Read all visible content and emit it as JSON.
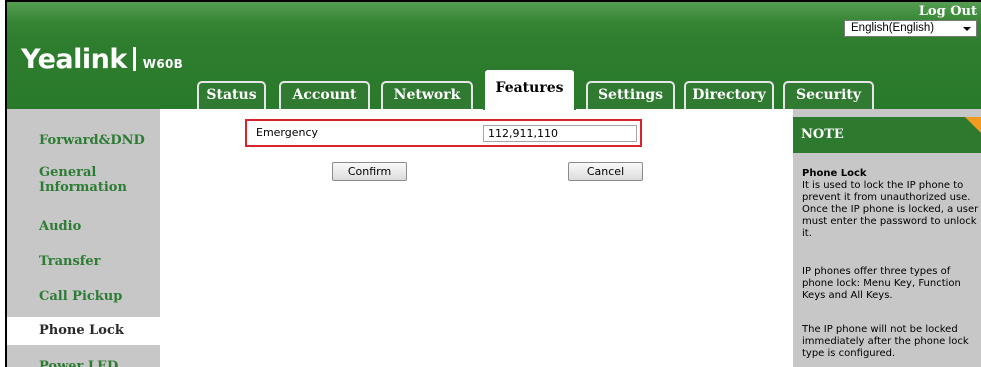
{
  "header": {
    "brand": "Yealink",
    "model": "W60B",
    "logout_label": "Log Out",
    "language": "English(English)"
  },
  "tabs": [
    {
      "label": "Status"
    },
    {
      "label": "Account"
    },
    {
      "label": "Network"
    },
    {
      "label": "Features",
      "active": true
    },
    {
      "label": "Settings"
    },
    {
      "label": "Directory"
    },
    {
      "label": "Security"
    }
  ],
  "sidebar": {
    "items": [
      {
        "label": "Forward&DND"
      },
      {
        "label": "General Information"
      },
      {
        "label": "Audio"
      },
      {
        "label": "Transfer"
      },
      {
        "label": "Call Pickup"
      },
      {
        "label": "Phone Lock",
        "active": true
      },
      {
        "label": "Power LED"
      }
    ]
  },
  "form": {
    "emergency_label": "Emergency",
    "emergency_value": "112,911,110",
    "confirm_label": "Confirm",
    "cancel_label": "Cancel"
  },
  "note": {
    "header": "NOTE",
    "title": "Phone Lock",
    "paragraph1": "It is used to lock the IP phone to prevent it from unauthorized use. Once the IP phone is locked, a user must enter the password to unlock it.",
    "paragraph2": "IP phones offer three types of phone lock: Menu Key, Function Keys and All Keys.",
    "paragraph3": "The IP phone will not be locked immediately after the phone lock type is configured."
  },
  "colors": {
    "header_green": "#2f7d2f",
    "nav_green": "#2c7c34",
    "sidebar_gray": "#c7c7c7",
    "highlight_red": "#d9232d",
    "note_corner_orange": "#f39a21"
  }
}
